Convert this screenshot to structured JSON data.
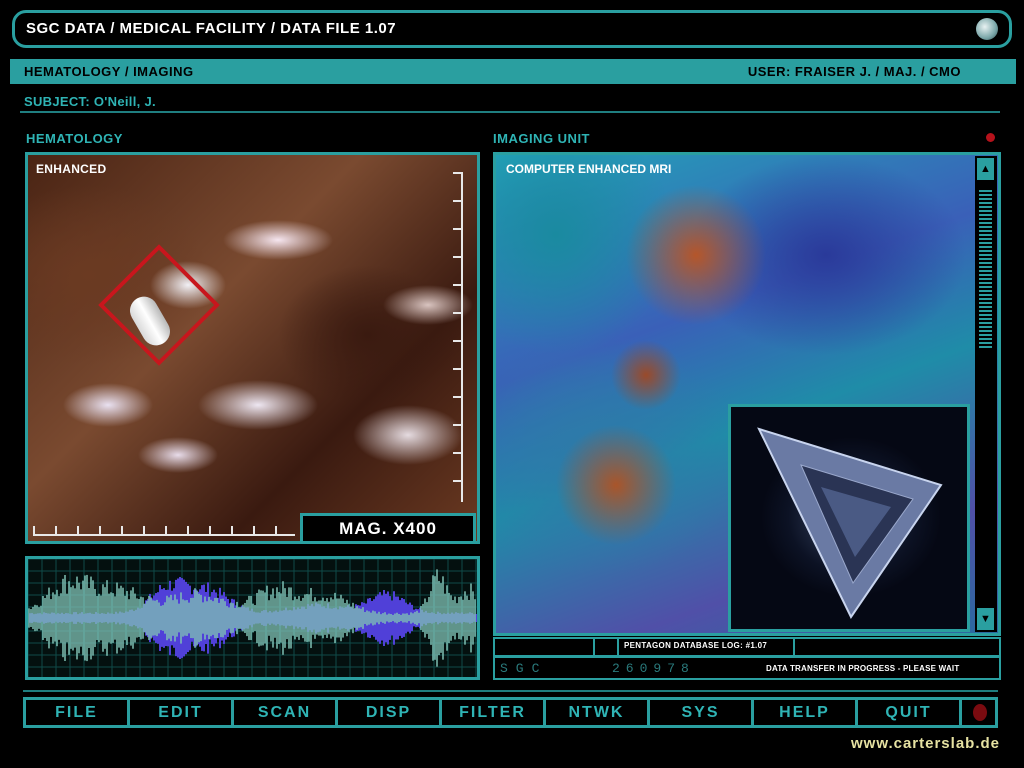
{
  "app": {
    "title": "SGC DATA / MEDICAL FACILITY / DATA FILE 1.07",
    "logo_icon": "stargate-emblem-icon"
  },
  "header": {
    "section": "HEMATOLOGY / IMAGING",
    "user": "USER: FRAISER J. / MAJ. / CMO",
    "subject": "SUBJECT: O'Neill, J."
  },
  "hematology": {
    "title": "HEMATOLOGY",
    "overlay_label": "ENHANCED",
    "magnification": "MAG. X400",
    "target_icon": "target-reticle-icon"
  },
  "imaging": {
    "title": "IMAGING UNIT",
    "overlay_label": "COMPUTER ENHANCED MRI",
    "status_indicator_color": "#b5121b",
    "scroll_up_icon": "arrow-up-icon",
    "scroll_down_icon": "arrow-down-icon",
    "inset_object": "pyramid-object-icon"
  },
  "log": {
    "label": "PENTAGON DATABASE LOG: #1.07",
    "code": "SGC",
    "serial": "260978",
    "status": "DATA TRANSFER IN PROGRESS - PLEASE WAIT"
  },
  "menu": {
    "items": [
      "FILE",
      "EDIT",
      "SCAN",
      "DISP",
      "FILTER",
      "NTWK",
      "SYS",
      "HELP",
      "QUIT"
    ],
    "power_icon": "power-button-icon"
  },
  "footer": {
    "website": "www.carterslab.de"
  },
  "colors": {
    "accent": "#2a9fa0",
    "accent_text": "#2fb4b5",
    "alert": "#c8161d",
    "footer_text": "#e6e2a2",
    "waveform_primary": "#7fc0b4",
    "waveform_secondary": "#5040d8"
  }
}
